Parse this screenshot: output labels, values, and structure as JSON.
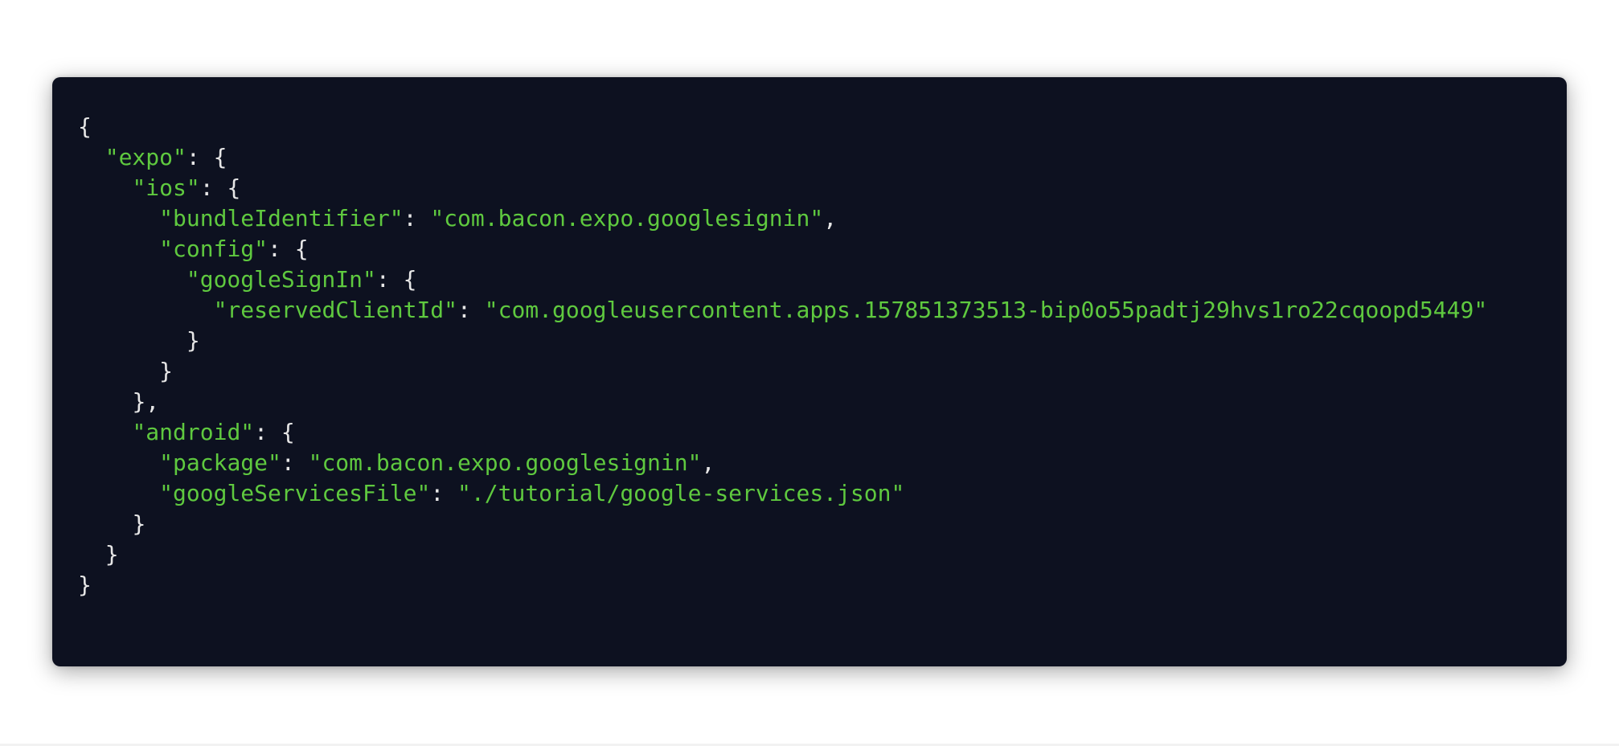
{
  "code": {
    "lines": [
      [
        {
          "t": "punct",
          "v": "{"
        }
      ],
      [
        {
          "t": "ws",
          "v": "  "
        },
        {
          "t": "key",
          "v": "\"expo\""
        },
        {
          "t": "punct",
          "v": ": {"
        }
      ],
      [
        {
          "t": "ws",
          "v": "    "
        },
        {
          "t": "key",
          "v": "\"ios\""
        },
        {
          "t": "punct",
          "v": ": {"
        }
      ],
      [
        {
          "t": "ws",
          "v": "      "
        },
        {
          "t": "key",
          "v": "\"bundleIdentifier\""
        },
        {
          "t": "punct",
          "v": ": "
        },
        {
          "t": "str",
          "v": "\"com.bacon.expo.googlesignin\""
        },
        {
          "t": "punct",
          "v": ","
        }
      ],
      [
        {
          "t": "ws",
          "v": "      "
        },
        {
          "t": "key",
          "v": "\"config\""
        },
        {
          "t": "punct",
          "v": ": {"
        }
      ],
      [
        {
          "t": "ws",
          "v": "        "
        },
        {
          "t": "key",
          "v": "\"googleSignIn\""
        },
        {
          "t": "punct",
          "v": ": {"
        }
      ],
      [
        {
          "t": "ws",
          "v": "          "
        },
        {
          "t": "key",
          "v": "\"reservedClientId\""
        },
        {
          "t": "punct",
          "v": ": "
        },
        {
          "t": "str",
          "v": "\"com.googleusercontent.apps.157851373513-bip0o55padtj29hvs1ro22cqoopd5449\""
        }
      ],
      [
        {
          "t": "ws",
          "v": "        "
        },
        {
          "t": "punct",
          "v": "}"
        }
      ],
      [
        {
          "t": "ws",
          "v": "      "
        },
        {
          "t": "punct",
          "v": "}"
        }
      ],
      [
        {
          "t": "ws",
          "v": "    "
        },
        {
          "t": "punct",
          "v": "},"
        }
      ],
      [
        {
          "t": "ws",
          "v": "    "
        },
        {
          "t": "key",
          "v": "\"android\""
        },
        {
          "t": "punct",
          "v": ": {"
        }
      ],
      [
        {
          "t": "ws",
          "v": "      "
        },
        {
          "t": "key",
          "v": "\"package\""
        },
        {
          "t": "punct",
          "v": ": "
        },
        {
          "t": "str",
          "v": "\"com.bacon.expo.googlesignin\""
        },
        {
          "t": "punct",
          "v": ","
        }
      ],
      [
        {
          "t": "ws",
          "v": "      "
        },
        {
          "t": "key",
          "v": "\"googleServicesFile\""
        },
        {
          "t": "punct",
          "v": ": "
        },
        {
          "t": "str",
          "v": "\"./tutorial/google-services.json\""
        }
      ],
      [
        {
          "t": "ws",
          "v": "    "
        },
        {
          "t": "punct",
          "v": "}"
        }
      ],
      [
        {
          "t": "ws",
          "v": "  "
        },
        {
          "t": "punct",
          "v": "}"
        }
      ],
      [
        {
          "t": "punct",
          "v": "}"
        }
      ]
    ]
  },
  "colors": {
    "background": "#0d1120",
    "key": "#5fc93f",
    "string": "#5fc93f",
    "punctuation": "#e6e6e6"
  }
}
